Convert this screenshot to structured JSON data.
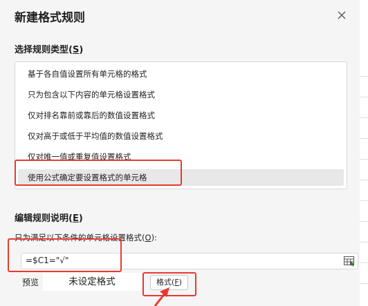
{
  "dialog": {
    "title": "新建格式规则",
    "close_symbol": "×"
  },
  "rule_type": {
    "label_text": "选择规则类型(",
    "label_key": "S",
    "label_end": ")",
    "items": [
      "基于各自值设置所有单元格的格式",
      "只为包含以下内容的单元格设置格式",
      "仅对排名靠前或靠后的数值设置格式",
      "仅对高于或低于平均值的数值设置格式",
      "仅对唯一值或重复值设置格式",
      "使用公式确定要设置格式的单元格"
    ],
    "selected_index": 5
  },
  "edit": {
    "label_text": "编辑规则说明(",
    "label_key": "E",
    "label_end": ")",
    "hint_text": "只为满足以下条件的单元格设置格式(",
    "hint_key": "O",
    "hint_end": "):",
    "formula": "=$C1=\"√\"",
    "preview_label": "预览",
    "preview_text": "未设定格式",
    "format_button_text": "格式(",
    "format_button_key": "F",
    "format_button_end": ")"
  },
  "colors": {
    "highlight": "#e8392f",
    "dialog_bg": "#f5f5f5",
    "selected_row": "#e8e8e8"
  },
  "icons": {
    "close": "close-icon",
    "range_picker": "range-select-icon",
    "arrow": "red-arrow-annotation"
  }
}
